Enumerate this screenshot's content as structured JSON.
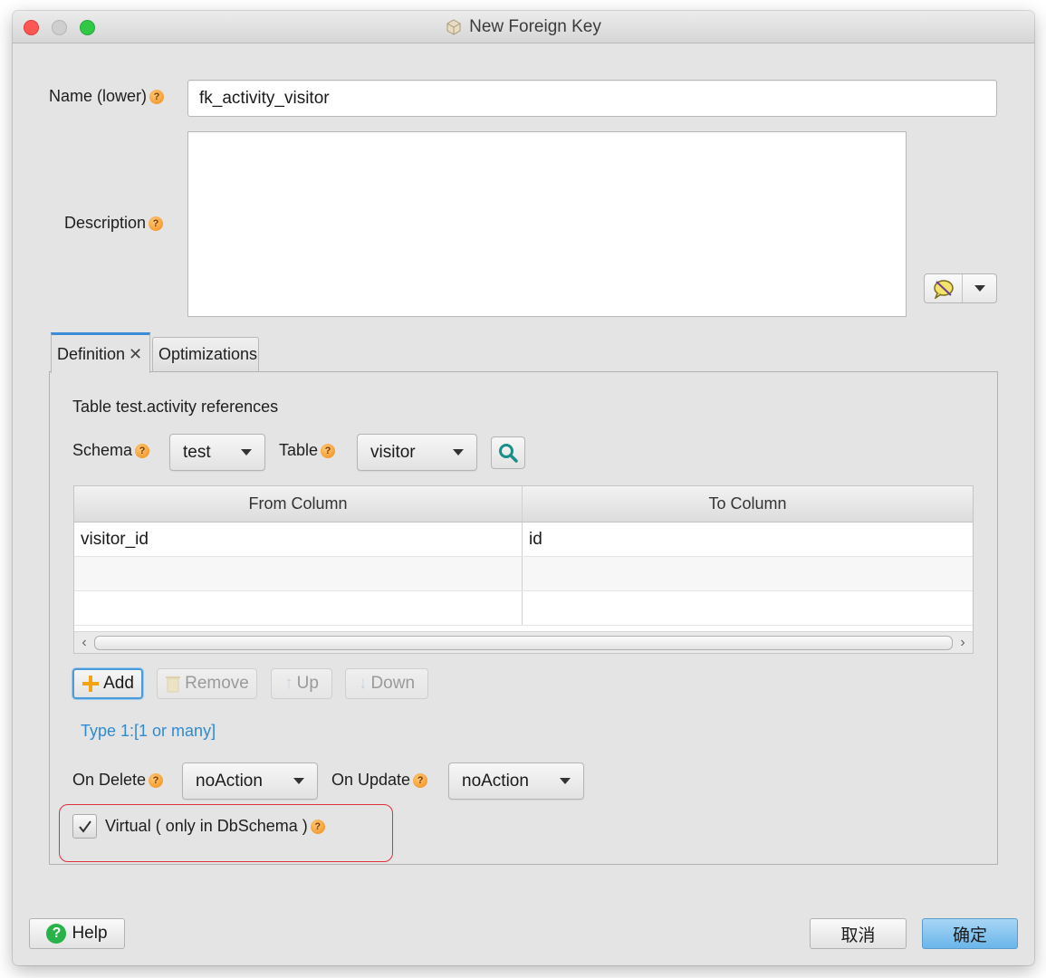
{
  "window": {
    "title": "New Foreign Key",
    "title_icon": "cube-icon"
  },
  "form": {
    "name_label": "Name (lower)",
    "name_value": "fk_activity_visitor",
    "description_label": "Description",
    "description_value": "",
    "help_glyph": "?"
  },
  "tabs": [
    {
      "label": "Definition",
      "active": true,
      "close_glyph": "✕"
    },
    {
      "label": "Optimizations",
      "active": false
    }
  ],
  "definition": {
    "heading": "Table test.activity references",
    "schema_label": "Schema",
    "schema_value": "test",
    "table_label": "Table",
    "table_value": "visitor",
    "columns_table": {
      "headers": [
        "From Column",
        "To Column"
      ],
      "rows": [
        [
          "visitor_id",
          "id"
        ],
        [
          "",
          ""
        ],
        [
          "",
          ""
        ]
      ]
    },
    "buttons": {
      "add": "Add",
      "remove": "Remove",
      "up": "Up",
      "down": "Down"
    },
    "type_link": "Type 1:[1 or many]",
    "on_delete_label": "On Delete",
    "on_delete_value": "noAction",
    "on_update_label": "On Update",
    "on_update_value": "noAction",
    "virtual_label": "Virtual ( only in DbSchema )",
    "virtual_checked": true
  },
  "footer": {
    "help_label": "Help",
    "cancel_label": "取消",
    "ok_label": "确定"
  },
  "colors": {
    "accent_blue": "#3b8bd6",
    "link_blue": "#2e8bd3",
    "highlight_red": "#e0303a",
    "help_orange": "#f08a14",
    "help_green": "#27b24a",
    "primary_button": "#6ab6ea"
  }
}
